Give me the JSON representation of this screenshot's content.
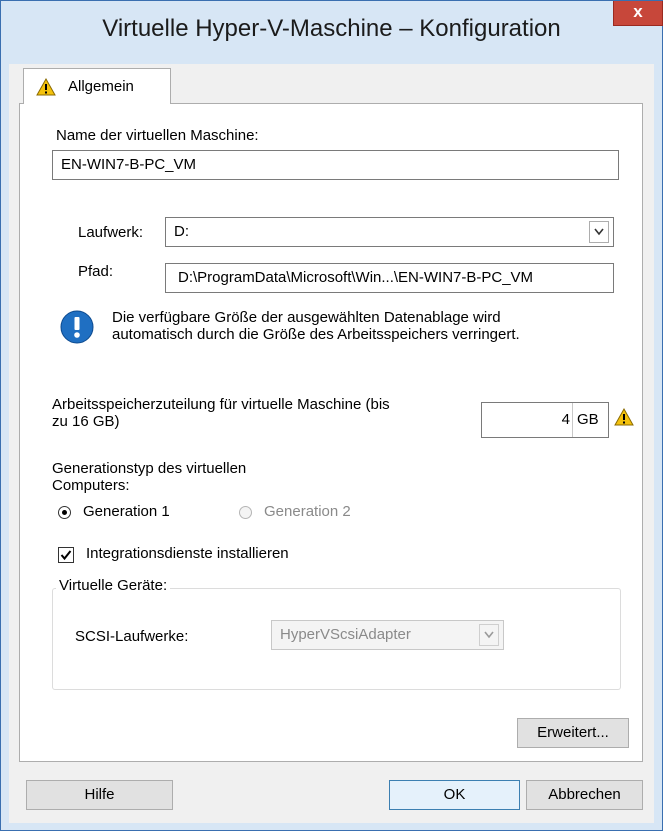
{
  "window": {
    "title": "Virtuelle Hyper-V-Maschine – Konfiguration",
    "close_glyph": "x"
  },
  "tabs": [
    {
      "label": "Allgemein"
    }
  ],
  "vm_name": {
    "label": "Name der virtuellen Maschine:",
    "value": "EN-WIN7-B-PC_VM"
  },
  "drive": {
    "label": "Laufwerk:",
    "value": "D:"
  },
  "path": {
    "label": "Pfad:",
    "value": "D:\\ProgramData\\Microsoft\\Win...\\EN-WIN7-B-PC_VM"
  },
  "info": {
    "line1": "Die verfügbare Größe der ausgewählten Datenablage wird",
    "line2": "automatisch durch die Größe des Arbeitsspeichers verringert."
  },
  "memory": {
    "label_line1": "Arbeitsspeicherzuteilung für virtuelle Maschine (bis",
    "label_line2": "zu 16 GB)",
    "value": "4",
    "unit": "GB"
  },
  "generation": {
    "label_line1": "Generationstyp des virtuellen",
    "label_line2": "Computers:",
    "options": [
      {
        "label": "Generation 1",
        "selected": true,
        "enabled": true
      },
      {
        "label": "Generation 2",
        "selected": false,
        "enabled": false
      }
    ]
  },
  "integration": {
    "label": "Integrationsdienste installieren",
    "checked": true
  },
  "virtual_devices": {
    "title": "Virtuelle Geräte:",
    "scsi_label": "SCSI-Laufwerke:",
    "scsi_value": "HyperVScsiAdapter"
  },
  "buttons": {
    "advanced": "Erweitert...",
    "help": "Hilfe",
    "ok": "OK",
    "cancel": "Abbrechen"
  },
  "colors": {
    "accent": "#3c7fb1",
    "close": "#c7473a",
    "info": "#1f6fc2",
    "warning": "#f4c20d"
  },
  "icons": {
    "tab": "warning-icon",
    "info": "info-icon",
    "memory": "warning-icon"
  }
}
